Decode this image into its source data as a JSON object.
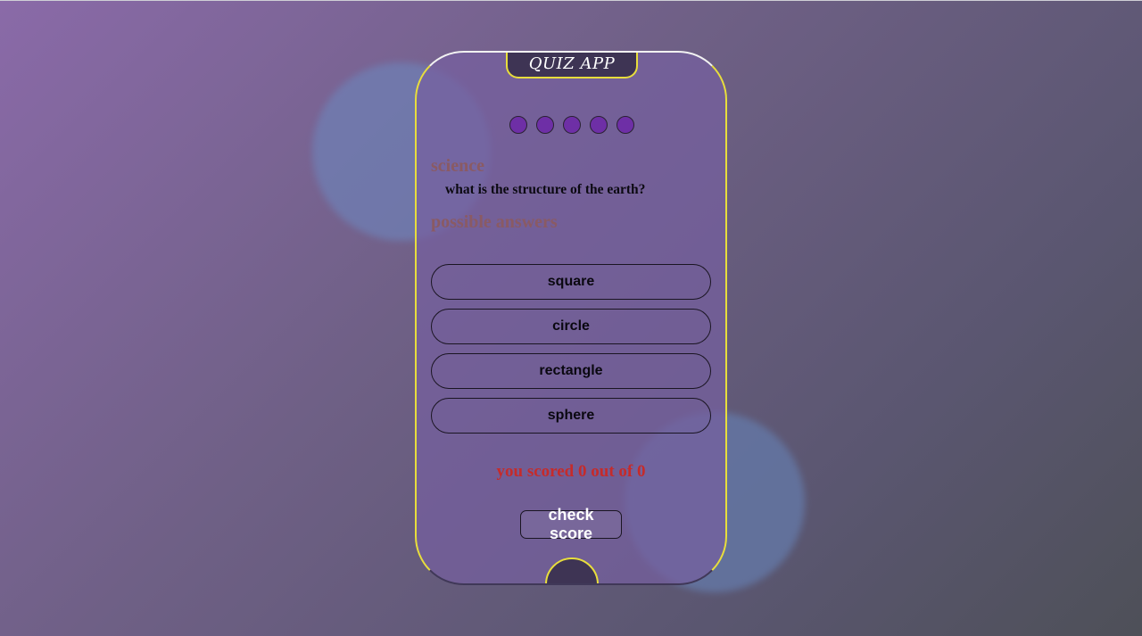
{
  "app": {
    "title": "QUIZ APP"
  },
  "progress": {
    "total": 5,
    "answered": 0
  },
  "question": {
    "category": "science",
    "text": "what is the structure of the earth?"
  },
  "answers": {
    "heading": "possible answers",
    "options": [
      "square",
      "circle",
      "rectangle",
      "sphere"
    ]
  },
  "score": {
    "text": "you scored 0 out of 0"
  },
  "actions": {
    "check_score_label": "check score"
  },
  "colors": {
    "accent_border": "#e8de3c",
    "dot_fill": "#6e2fa6",
    "category_text": "#8a5a63",
    "score_text": "#c52b2b",
    "notch_fill": "#3e3454"
  }
}
